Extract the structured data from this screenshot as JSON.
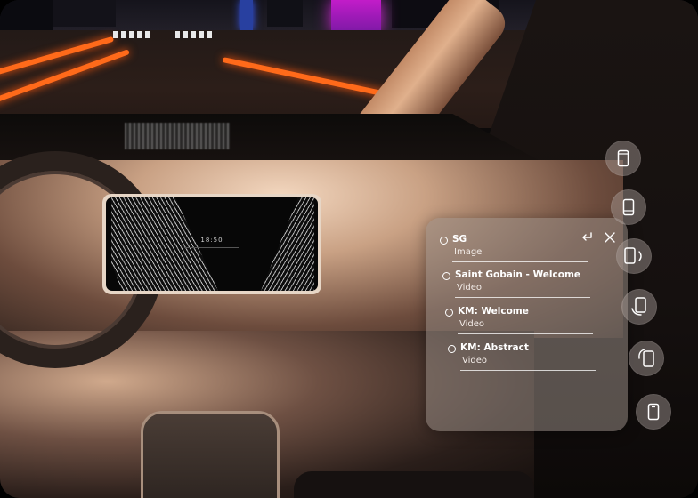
{
  "center_display": {
    "time": "18:50"
  },
  "media_panel": {
    "items": [
      {
        "title": "SG",
        "type": "Image"
      },
      {
        "title": "Saint Gobain - Welcome",
        "type": "Video"
      },
      {
        "title": "KM: Welcome",
        "type": "Video"
      },
      {
        "title": "KM: Abstract",
        "type": "Video"
      }
    ],
    "actions": [
      "back-icon",
      "close-icon"
    ]
  },
  "side_rail": {
    "buttons": [
      "device-icon",
      "device-tilt-icon",
      "device-rotate-right-icon",
      "device-rotate-down-icon",
      "device-rotate-left-icon",
      "device-small-icon"
    ]
  }
}
